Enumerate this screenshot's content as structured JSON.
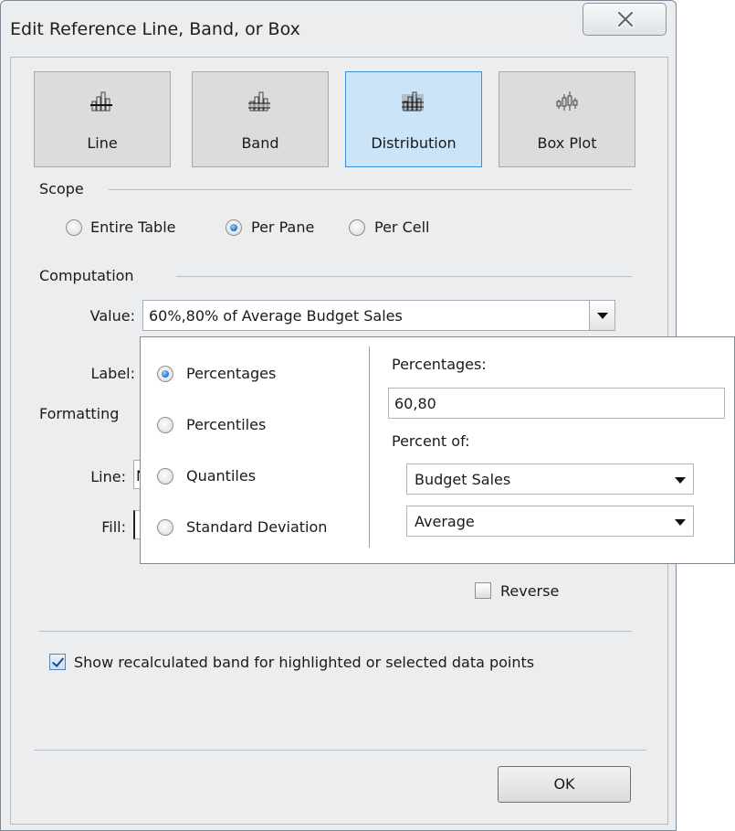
{
  "dialog": {
    "title": "Edit Reference Line, Band, or Box",
    "close_icon": "close-icon"
  },
  "types": [
    {
      "label": "Line",
      "icon": "line-chart-icon",
      "selected": false
    },
    {
      "label": "Band",
      "icon": "band-chart-icon",
      "selected": false
    },
    {
      "label": "Distribution",
      "icon": "distribution-chart-icon",
      "selected": true
    },
    {
      "label": "Box Plot",
      "icon": "box-plot-icon",
      "selected": false
    }
  ],
  "scope": {
    "label": "Scope",
    "options": [
      {
        "label": "Entire Table",
        "selected": false
      },
      {
        "label": "Per Pane",
        "selected": true
      },
      {
        "label": "Per Cell",
        "selected": false
      }
    ]
  },
  "computation": {
    "label": "Computation",
    "value_label": "Value:",
    "value": "60%,80% of Average Budget Sales",
    "label_label": "Label:"
  },
  "formatting": {
    "label": "Formatting",
    "line_label": "Line:",
    "line_value": "N",
    "fill_label": "Fill:"
  },
  "reverse": {
    "label": "Reverse",
    "checked": false
  },
  "recalc": {
    "label": "Show recalculated band for highlighted or selected data points",
    "checked": true
  },
  "ok_label": "OK",
  "popup": {
    "methods": [
      {
        "label": "Percentages",
        "selected": true
      },
      {
        "label": "Percentiles",
        "selected": false
      },
      {
        "label": "Quantiles",
        "selected": false
      },
      {
        "label": "Standard Deviation",
        "selected": false
      }
    ],
    "percentages_label": "Percentages:",
    "percentages_value": "60,80",
    "percent_of_label": "Percent of:",
    "field_select": "Budget Sales",
    "aggregation_select": "Average"
  },
  "colors": {
    "selected_button": "#cce4f7",
    "selected_border": "#3c8fd9",
    "dialog_bg": "#ecedef"
  }
}
